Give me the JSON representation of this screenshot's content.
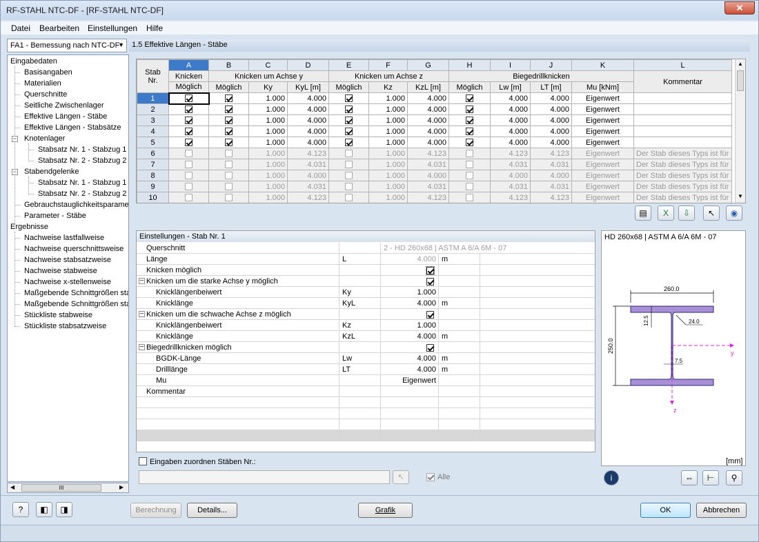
{
  "window": {
    "title": "RF-STAHL NTC-DF - [RF-STAHL NTC-DF]",
    "close": "✕"
  },
  "menu": [
    "Datei",
    "Bearbeiten",
    "Einstellungen",
    "Hilfe"
  ],
  "case_selector": "FA1 - Bemessung nach NTC-DF",
  "tree": {
    "input_header": "Eingabedaten",
    "items": [
      "Basisangaben",
      "Materialien",
      "Querschnitte",
      "Seitliche Zwischenlager",
      "Effektive Längen - Stäbe",
      "Effektive Längen - Stabsätze"
    ],
    "knotenlager": "Knotenlager",
    "knotenlager_items": [
      "Stabsatz Nr. 1 - Stabzug 1",
      "Stabsatz Nr. 2 - Stabzug 2"
    ],
    "stabendgelenke": "Stabendgelenke",
    "stabendgelenke_items": [
      "Stabsatz Nr. 1 - Stabzug 1",
      "Stabsatz Nr. 2 - Stabzug 2"
    ],
    "more": [
      "Gebrauchstauglichkeitsparamet",
      "Parameter - Stäbe"
    ],
    "results_header": "Ergebnisse",
    "results": [
      "Nachweise lastfallweise",
      "Nachweise querschnittsweise",
      "Nachweise stabsatzweise",
      "Nachweise stabweise",
      "Nachweise x-stellenweise",
      "Maßgebende Schnittgrößen sta",
      "Maßgebende Schnittgrößen sta",
      "Stückliste stabweise",
      "Stückliste stabsatzweise"
    ]
  },
  "hscroll_thumb": "III",
  "panel_title": "1.5 Effektive Längen - Stäbe",
  "grid": {
    "letters": [
      "A",
      "B",
      "C",
      "D",
      "E",
      "F",
      "G",
      "H",
      "I",
      "J",
      "K",
      "L"
    ],
    "h_stab": "Stab",
    "h_nr": "Nr.",
    "h_knicken": "Knicken",
    "h_achse_y": "Knicken um Achse y",
    "h_achse_z": "Knicken um Achse z",
    "h_bdk": "Biegedrillknicken",
    "sub": [
      "Möglich",
      "Möglich",
      "Ky",
      "KyL [m]",
      "Möglich",
      "Kz",
      "KzL [m]",
      "Möglich",
      "Lw [m]",
      "LT [m]",
      "Mu [kNm]",
      "Kommentar"
    ],
    "rows": [
      {
        "nr": "1",
        "ky": "1.000",
        "kyl": "4.000",
        "kz": "1.000",
        "kzl": "4.000",
        "lw": "4.000",
        "lt": "4.000",
        "mu": "Eigenwert",
        "kom": "",
        "on": true
      },
      {
        "nr": "2",
        "ky": "1.000",
        "kyl": "4.000",
        "kz": "1.000",
        "kzl": "4.000",
        "lw": "4.000",
        "lt": "4.000",
        "mu": "Eigenwert",
        "kom": "",
        "on": true
      },
      {
        "nr": "3",
        "ky": "1.000",
        "kyl": "4.000",
        "kz": "1.000",
        "kzl": "4.000",
        "lw": "4.000",
        "lt": "4.000",
        "mu": "Eigenwert",
        "kom": "",
        "on": true
      },
      {
        "nr": "4",
        "ky": "1.000",
        "kyl": "4.000",
        "kz": "1.000",
        "kzl": "4.000",
        "lw": "4.000",
        "lt": "4.000",
        "mu": "Eigenwert",
        "kom": "",
        "on": true
      },
      {
        "nr": "5",
        "ky": "1.000",
        "kyl": "4.000",
        "kz": "1.000",
        "kzl": "4.000",
        "lw": "4.000",
        "lt": "4.000",
        "mu": "Eigenwert",
        "kom": "",
        "on": true
      },
      {
        "nr": "6",
        "ky": "1.000",
        "kyl": "4.123",
        "kz": "1.000",
        "kzl": "4.123",
        "lw": "4.123",
        "lt": "4.123",
        "mu": "Eigenwert",
        "kom": "Der Stab dieses Typs ist für",
        "on": false
      },
      {
        "nr": "7",
        "ky": "1.000",
        "kyl": "4.031",
        "kz": "1.000",
        "kzl": "4.031",
        "lw": "4.031",
        "lt": "4.031",
        "mu": "Eigenwert",
        "kom": "Der Stab dieses Typs ist für",
        "on": false
      },
      {
        "nr": "8",
        "ky": "1.000",
        "kyl": "4.000",
        "kz": "1.000",
        "kzl": "4.000",
        "lw": "4.000",
        "lt": "4.000",
        "mu": "Eigenwert",
        "kom": "Der Stab dieses Typs ist für",
        "on": false
      },
      {
        "nr": "9",
        "ky": "1.000",
        "kyl": "4.031",
        "kz": "1.000",
        "kzl": "4.031",
        "lw": "4.031",
        "lt": "4.031",
        "mu": "Eigenwert",
        "kom": "Der Stab dieses Typs ist für",
        "on": false
      },
      {
        "nr": "10",
        "ky": "1.000",
        "kyl": "4.123",
        "kz": "1.000",
        "kzl": "4.123",
        "lw": "4.123",
        "lt": "4.123",
        "mu": "Eigenwert",
        "kom": "Der Stab dieses Typs ist für",
        "on": false
      }
    ]
  },
  "settings": {
    "title": "Einstellungen - Stab Nr. 1",
    "rows": [
      {
        "label": "Querschnitt",
        "sym": "",
        "val": "2 - HD 260x68 | ASTM A 6/A 6M - 07",
        "unit": "",
        "indent": 0,
        "gray": true
      },
      {
        "label": "Länge",
        "sym": "L",
        "val": "4.000",
        "unit": "m",
        "indent": 0,
        "gray": true
      },
      {
        "label": "Knicken möglich",
        "sym": "",
        "val": "",
        "unit": "",
        "indent": 0,
        "check": true
      },
      {
        "label": "Knicken um die starke Achse y möglich",
        "sym": "",
        "val": "",
        "unit": "",
        "indent": 0,
        "check": true,
        "group": true
      },
      {
        "label": "Knicklängenbeiwert",
        "sym": "Ky",
        "val": "1.000",
        "unit": "",
        "indent": 2
      },
      {
        "label": "Knicklänge",
        "sym": "KyL",
        "val": "4.000",
        "unit": "m",
        "indent": 2
      },
      {
        "label": "Knicken um die schwache Achse z möglich",
        "sym": "",
        "val": "",
        "unit": "",
        "indent": 0,
        "check": true,
        "group": true
      },
      {
        "label": "Knicklängenbeiwert",
        "sym": "Kz",
        "val": "1.000",
        "unit": "",
        "indent": 2
      },
      {
        "label": "Knicklänge",
        "sym": "KzL",
        "val": "4.000",
        "unit": "m",
        "indent": 2
      },
      {
        "label": "Biegedrillknicken möglich",
        "sym": "",
        "val": "",
        "unit": "",
        "indent": 0,
        "check": true,
        "group": true
      },
      {
        "label": "BGDK-Länge",
        "sym": "Lw",
        "val": "4.000",
        "unit": "m",
        "indent": 2
      },
      {
        "label": "Drilllänge",
        "sym": "LT",
        "val": "4.000",
        "unit": "m",
        "indent": 2
      },
      {
        "label": "Mu",
        "sym": "",
        "val": "Eigenwert",
        "unit": "",
        "indent": 2
      },
      {
        "label": "Kommentar",
        "sym": "",
        "val": "",
        "unit": "",
        "indent": 0
      }
    ],
    "assign_label": "Eingaben zuordnen Stäben Nr.:",
    "alle": "Alle"
  },
  "preview": {
    "title": "HD 260x68 | ASTM A 6/A 6M - 07",
    "dim_b": "260.0",
    "dim_h": "250.0",
    "dim_tf": "12.5",
    "dim_r": "24.0",
    "dim_tw": "7.5",
    "axis_y": "y",
    "axis_z": "z",
    "unit": "[mm]",
    "section_color": "#a98fd6"
  },
  "buttons": {
    "berechnung": "Berechnung",
    "details": "Details...",
    "grafik": "Grafik",
    "ok": "OK",
    "abbrechen": "Abbrechen"
  }
}
